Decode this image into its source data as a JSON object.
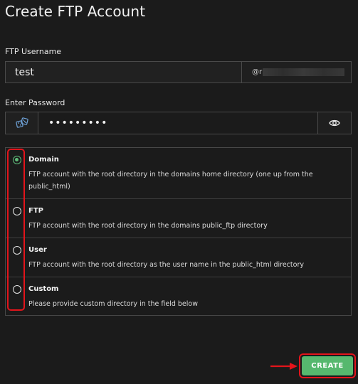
{
  "page": {
    "title": "Create FTP Account"
  },
  "username": {
    "label": "FTP Username",
    "value": "test",
    "domain_prefix": "@r"
  },
  "password": {
    "label": "Enter Password",
    "masked_value": "•••••••••",
    "generate_icon": "dice-icon",
    "toggle_icon": "eye-icon"
  },
  "options": [
    {
      "title": "Domain",
      "description": "FTP account with the root directory in the domains home directory (one up from the public_html)",
      "selected": true
    },
    {
      "title": "FTP",
      "description": "FTP account with the root directory in the domains public_ftp directory",
      "selected": false
    },
    {
      "title": "User",
      "description": "FTP account with the root directory as the user name in the public_html directory",
      "selected": false
    },
    {
      "title": "Custom",
      "description": "Please provide custom directory in the field below",
      "selected": false
    }
  ],
  "actions": {
    "create_label": "CREATE"
  },
  "colors": {
    "accent_green": "#56b86e",
    "annotation_red": "#e3141b",
    "background": "#1b1b1b"
  }
}
